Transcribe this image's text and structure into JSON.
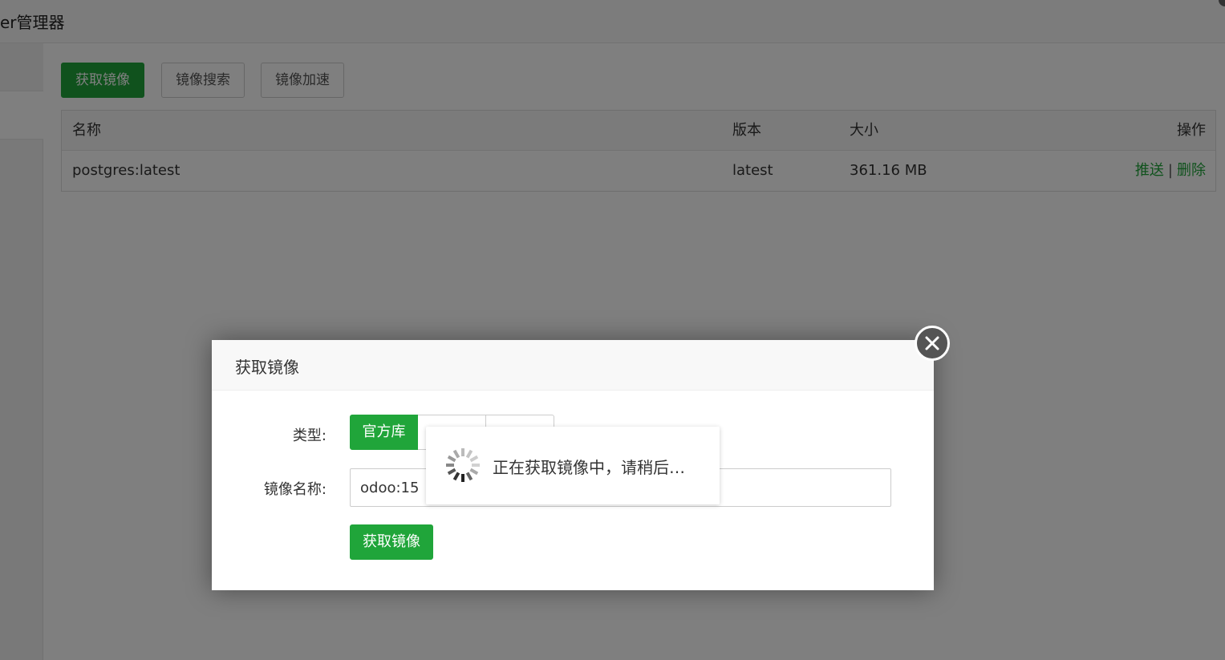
{
  "header": {
    "title": "er管理器"
  },
  "toolbar": {
    "get_image": "获取镜像",
    "search_image": "镜像搜索",
    "accelerate": "镜像加速"
  },
  "table": {
    "columns": {
      "name": "名称",
      "version": "版本",
      "size": "大小",
      "action": "操作"
    },
    "rows": [
      {
        "name": "postgres:latest",
        "version": "latest",
        "size": "361.16 MB",
        "push": "推送",
        "separator": "|",
        "delete": "删除"
      }
    ]
  },
  "modal": {
    "title": "获取镜像",
    "type_label": "类型:",
    "type_options": [
      "官方库"
    ],
    "name_label": "镜像名称:",
    "name_value": "odoo:15",
    "submit": "获取镜像"
  },
  "loading": {
    "message": "正在获取镜像中，请稍后…"
  },
  "icons": {
    "close": "close-icon",
    "spinner": "spinner-icon"
  },
  "colors": {
    "accent": "#20a53a",
    "overlay": "rgba(0,0,0,0.5)"
  }
}
